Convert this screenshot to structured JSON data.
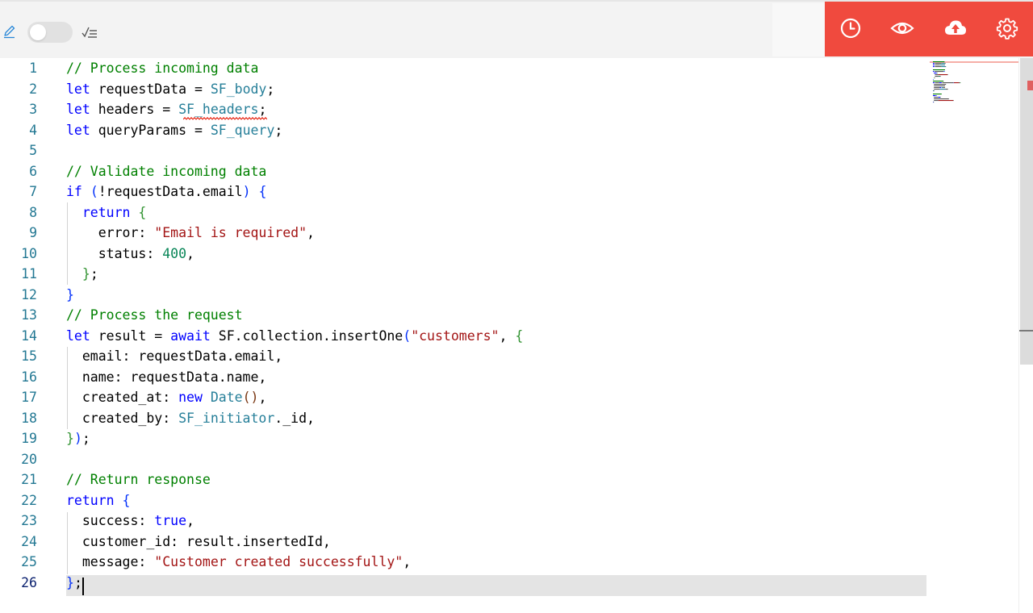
{
  "toolbar": {
    "edit_icon": "pencil-icon",
    "toggle_state": "off",
    "format_icon": "checklist-icon",
    "actions": [
      {
        "name": "history",
        "icon": "clock-icon"
      },
      {
        "name": "preview",
        "icon": "eye-icon"
      },
      {
        "name": "deploy",
        "icon": "cloud-upload-icon"
      },
      {
        "name": "settings",
        "icon": "gear-icon"
      }
    ],
    "accent_color": "#f04a3e"
  },
  "editor": {
    "current_line": 26,
    "lines": [
      {
        "n": "1",
        "tokens": [
          {
            "t": "// Process incoming data",
            "c": "cm"
          }
        ]
      },
      {
        "n": "2",
        "tokens": [
          {
            "t": "let",
            "c": "kw"
          },
          {
            "t": " requestData = ",
            "c": "pl"
          },
          {
            "t": "SF_body",
            "c": "gl"
          },
          {
            "t": ";",
            "c": "pl"
          }
        ]
      },
      {
        "n": "3",
        "tokens": [
          {
            "t": "let",
            "c": "kw"
          },
          {
            "t": " headers = ",
            "c": "pl"
          },
          {
            "t": "SF_headers",
            "c": "gl"
          },
          {
            "t": ";",
            "c": "pl"
          }
        ]
      },
      {
        "n": "4",
        "tokens": [
          {
            "t": "let",
            "c": "kw"
          },
          {
            "t": " queryParams = ",
            "c": "pl"
          },
          {
            "t": "SF_query",
            "c": "gl"
          },
          {
            "t": ";",
            "c": "pl"
          }
        ]
      },
      {
        "n": "5",
        "tokens": []
      },
      {
        "n": "6",
        "tokens": [
          {
            "t": "// Validate incoming data",
            "c": "cm"
          }
        ]
      },
      {
        "n": "7",
        "tokens": [
          {
            "t": "if",
            "c": "kw"
          },
          {
            "t": " ",
            "c": "pl"
          },
          {
            "t": "(",
            "c": "br1"
          },
          {
            "t": "!requestData.email",
            "c": "pl"
          },
          {
            "t": ")",
            "c": "br1"
          },
          {
            "t": " ",
            "c": "pl"
          },
          {
            "t": "{",
            "c": "br1"
          }
        ]
      },
      {
        "n": "8",
        "tokens": [
          {
            "t": "  return",
            "c": "kw"
          },
          {
            "t": " ",
            "c": "pl"
          },
          {
            "t": "{",
            "c": "br2"
          }
        ]
      },
      {
        "n": "9",
        "tokens": [
          {
            "t": "    error: ",
            "c": "pl"
          },
          {
            "t": "\"Email is required\"",
            "c": "st"
          },
          {
            "t": ",",
            "c": "pl"
          }
        ]
      },
      {
        "n": "10",
        "tokens": [
          {
            "t": "    status: ",
            "c": "pl"
          },
          {
            "t": "400",
            "c": "nu"
          },
          {
            "t": ",",
            "c": "pl"
          }
        ]
      },
      {
        "n": "11",
        "tokens": [
          {
            "t": "  ",
            "c": "pl"
          },
          {
            "t": "}",
            "c": "br2"
          },
          {
            "t": ";",
            "c": "pl"
          }
        ]
      },
      {
        "n": "12",
        "tokens": [
          {
            "t": "}",
            "c": "br1"
          }
        ]
      },
      {
        "n": "13",
        "tokens": [
          {
            "t": "// Process the request",
            "c": "cm"
          }
        ]
      },
      {
        "n": "14",
        "tokens": [
          {
            "t": "let",
            "c": "kw"
          },
          {
            "t": " result = ",
            "c": "pl"
          },
          {
            "t": "await",
            "c": "kw"
          },
          {
            "t": " SF.collection.insertOne",
            "c": "pl"
          },
          {
            "t": "(",
            "c": "br1"
          },
          {
            "t": "\"customers\"",
            "c": "st"
          },
          {
            "t": ", ",
            "c": "pl"
          },
          {
            "t": "{",
            "c": "br2"
          }
        ]
      },
      {
        "n": "15",
        "tokens": [
          {
            "t": "  email: requestData.email,",
            "c": "pl"
          }
        ]
      },
      {
        "n": "16",
        "tokens": [
          {
            "t": "  name: requestData.name,",
            "c": "pl"
          }
        ]
      },
      {
        "n": "17",
        "tokens": [
          {
            "t": "  created_at: ",
            "c": "pl"
          },
          {
            "t": "new",
            "c": "kw"
          },
          {
            "t": " ",
            "c": "pl"
          },
          {
            "t": "Date",
            "c": "gl"
          },
          {
            "t": "()",
            "c": "br3"
          },
          {
            "t": ",",
            "c": "pl"
          }
        ]
      },
      {
        "n": "18",
        "tokens": [
          {
            "t": "  created_by: ",
            "c": "pl"
          },
          {
            "t": "SF_initiator",
            "c": "gl"
          },
          {
            "t": "._id,",
            "c": "pl"
          }
        ]
      },
      {
        "n": "19",
        "tokens": [
          {
            "t": "}",
            "c": "br2"
          },
          {
            "t": ")",
            "c": "br1"
          },
          {
            "t": ";",
            "c": "pl"
          }
        ]
      },
      {
        "n": "20",
        "tokens": []
      },
      {
        "n": "21",
        "tokens": [
          {
            "t": "// Return response",
            "c": "cm"
          }
        ]
      },
      {
        "n": "22",
        "tokens": [
          {
            "t": "return",
            "c": "kw"
          },
          {
            "t": " ",
            "c": "pl"
          },
          {
            "t": "{",
            "c": "br1"
          }
        ]
      },
      {
        "n": "23",
        "tokens": [
          {
            "t": "  success: ",
            "c": "pl"
          },
          {
            "t": "true",
            "c": "kw"
          },
          {
            "t": ",",
            "c": "pl"
          }
        ]
      },
      {
        "n": "24",
        "tokens": [
          {
            "t": "  customer_id: result.insertedId,",
            "c": "pl"
          }
        ]
      },
      {
        "n": "25",
        "tokens": [
          {
            "t": "  message: ",
            "c": "pl"
          },
          {
            "t": "\"Customer created successfully\"",
            "c": "st"
          },
          {
            "t": ",",
            "c": "pl"
          }
        ]
      },
      {
        "n": "26",
        "tokens": [
          {
            "t": "}",
            "c": "br1"
          },
          {
            "t": ";",
            "c": "pl"
          }
        ]
      }
    ]
  }
}
